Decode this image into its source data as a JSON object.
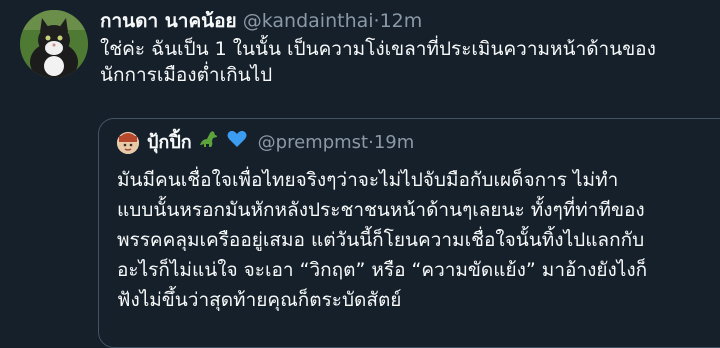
{
  "tweet": {
    "display_name": "กานดา นาคน้อย",
    "handle": "@kandainthai",
    "separator": "·",
    "time": "12m",
    "text_lines": [
      "ใช่ค่ะ ฉันเป็น 1 ในนั้น  เป็นความโง่เขลาที่ประเมินความหน้าด้านของ",
      "นักการเมืองต่ำเกินไป"
    ]
  },
  "quote": {
    "display_name": "ปุ้กปิ้ก",
    "emojis": [
      "dinosaur-emoji",
      "blue-heart-emoji"
    ],
    "handle": "@prempmst",
    "separator": "·",
    "time": "19m",
    "text_lines": [
      "มันมีคนเชื่อใจเพื่อไทยจริงๆว่าจะไม่ไปจับมือกับเผด็จการ ไม่ทำ",
      "แบบนั้นหรอกมันหักหลังประชาชนหน้าด้านๆเลยนะ ทั้งๆที่ท่าทีของ",
      "พรรคคลุมเครืออยู่เสมอ แต่วันนี้ก็โยนความเชื่อใจนั้นทิ้งไปแลกกับ",
      "อะไรก็ไม่แน่ใจ จะเอา “วิกฤต” หรือ “ความขัดแย้ง” มาอ้างยังไงก็",
      "ฟังไม่ขึ้นว่าสุดท้ายคุณก็ตระบัดสัตย์"
    ]
  },
  "colors": {
    "background": "#15202b",
    "text": "#f7f9f9",
    "secondary": "#8b98a5",
    "border": "#425364"
  }
}
